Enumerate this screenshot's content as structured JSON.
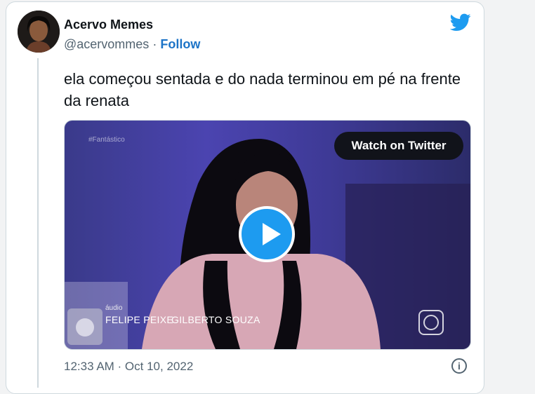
{
  "author": {
    "name": "Acervo Memes",
    "handle": "@acervommes",
    "separator": "·",
    "follow_label": "Follow"
  },
  "tweet": {
    "text": "ela começou sentada e do nada terminou em pé na frente da renata",
    "timestamp": "12:33 AM · Oct 10, 2022"
  },
  "video": {
    "watermark": "#Fantástico",
    "watch_label": "Watch on Twitter",
    "audio_label": "áudio",
    "credit_1": "FELIPE PEIXE",
    "credit_2": "GILBERTO SOUZA"
  },
  "icons": {
    "brand": "twitter-bird-icon",
    "info": "info-icon",
    "play": "play-icon"
  },
  "colors": {
    "brand_blue": "#1d9bf0",
    "follow_link": "#1d74c7",
    "text_primary": "#0f1419",
    "text_secondary": "#536471"
  }
}
